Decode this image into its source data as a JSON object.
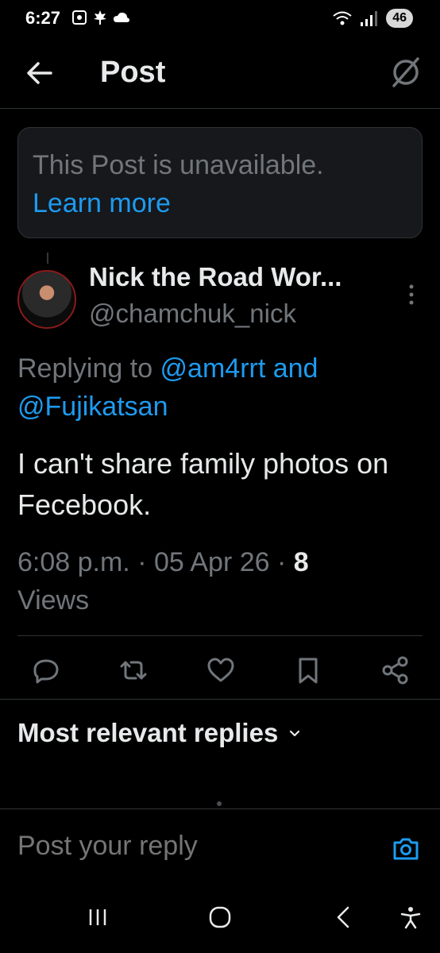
{
  "status_bar": {
    "time": "6:27",
    "battery": "46"
  },
  "header": {
    "title": "Post"
  },
  "unavailable": {
    "message": "This Post is unavailable.",
    "link": "Learn more"
  },
  "post": {
    "author_name": "Nick the Road Wor...",
    "author_handle": "@chamchuk_nick",
    "replying_prefix": "Replying to ",
    "mention_1": "@am4rrt",
    "conj": " and",
    "mention_2": "@Fujikatsan",
    "text": "I can't share family photos on Fecebook.",
    "time": "6:08 p.m.",
    "sep": " · ",
    "date": "05 Apr 26",
    "views_count": "8",
    "views_label": "Views"
  },
  "replies": {
    "sort_label": "Most relevant replies"
  },
  "composer": {
    "placeholder": "Post your reply"
  },
  "colors": {
    "accent": "#1d9bf0",
    "muted": "#71767b",
    "text": "#e7e9ea",
    "background": "#000000"
  },
  "icons": {
    "back": "arrow-left-icon",
    "grok": "grok-icon",
    "reply": "reply-icon",
    "repost": "repost-icon",
    "like": "heart-icon",
    "bookmark": "bookmark-icon",
    "share": "share-icon",
    "camera": "camera-icon"
  }
}
